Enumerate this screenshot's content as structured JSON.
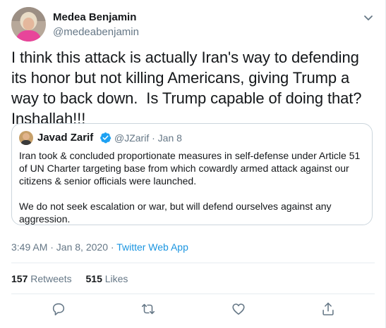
{
  "author": {
    "name": "Medea Benjamin",
    "handle": "@medeabenjamin",
    "avatar_icon": "profile-photo"
  },
  "tweet": {
    "text": "I think this attack is actually Iran's way to defending its honor but not killing Americans, giving Trump a way to back down.  Is Trump capable of doing that? Inshallah!!!"
  },
  "quoted_tweet": {
    "name": "Javad Zarif",
    "verified": true,
    "handle": "@JZarif",
    "separator": "·",
    "date": "Jan 8",
    "paragraphs": [
      "Iran took & concluded proportionate measures in self-defense under Article 51 of UN Charter targeting base from which cowardly armed attack against our citizens & senior officials were launched.",
      "We do not seek escalation or war, but will defend ourselves against any aggression."
    ]
  },
  "timestamp": {
    "time_date": "3:49 AM · Jan 8, 2020",
    "separator": "·",
    "source": "Twitter Web App"
  },
  "stats": {
    "retweets_count": "157",
    "retweets_label": "Retweets",
    "likes_count": "515",
    "likes_label": "Likes"
  },
  "actions": {
    "icons": [
      "reply-icon",
      "retweet-icon",
      "like-icon",
      "share-icon"
    ]
  },
  "colors": {
    "text": "#14171a",
    "secondary": "#657786",
    "link": "#1b95e0",
    "border": "#ccd6dd",
    "divider": "#e6ecf0",
    "verified": "#1da1f2"
  }
}
